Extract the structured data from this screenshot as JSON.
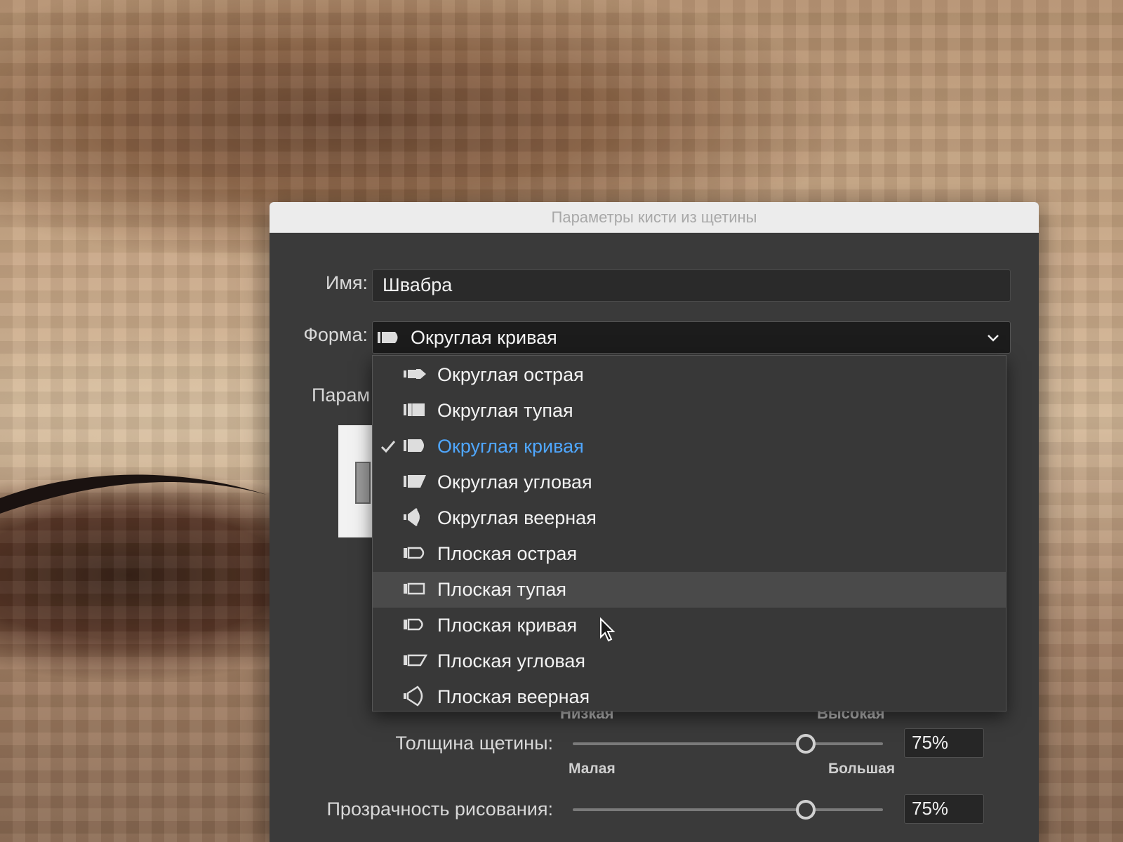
{
  "dialog": {
    "title": "Параметры кисти из щетины",
    "name_label": "Имя:",
    "name_value": "Швабра",
    "shape_label": "Форма:",
    "shape_value": "Округлая кривая",
    "params_label_partial": "Парам"
  },
  "shape_menu": {
    "items": [
      {
        "label": "Округлая острая",
        "icon": "round-point-brush-icon"
      },
      {
        "label": "Округлая тупая",
        "icon": "round-blunt-brush-icon"
      },
      {
        "label": "Округлая кривая",
        "icon": "round-curve-brush-icon",
        "selected": true
      },
      {
        "label": "Округлая угловая",
        "icon": "round-angle-brush-icon"
      },
      {
        "label": "Округлая веерная",
        "icon": "round-fan-brush-icon"
      },
      {
        "label": "Плоская острая",
        "icon": "flat-point-brush-icon"
      },
      {
        "label": "Плоская тупая",
        "icon": "flat-blunt-brush-icon",
        "hovered": true
      },
      {
        "label": "Плоская кривая",
        "icon": "flat-curve-brush-icon"
      },
      {
        "label": "Плоская угловая",
        "icon": "flat-angle-brush-icon"
      },
      {
        "label": "Плоская веерная",
        "icon": "flat-fan-brush-icon"
      }
    ]
  },
  "density_partial": {
    "min_label": "Низкая",
    "max_label": "Высокая"
  },
  "thickness": {
    "label": "Толщина щетины:",
    "value": "75%",
    "level": 0.75,
    "min_label": "Малая",
    "max_label": "Большая"
  },
  "opacity": {
    "label": "Прозрачность рисования:",
    "value": "75%",
    "level": 0.75
  },
  "colors": {
    "selected_text": "#4fa7ff",
    "dialog_bg": "#3a3a3a",
    "titlebar_bg": "#ececec"
  }
}
